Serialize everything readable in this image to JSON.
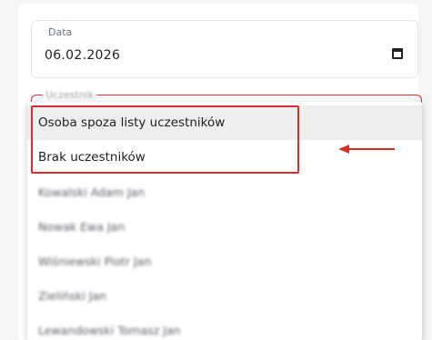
{
  "date_field": {
    "label": "Data",
    "value": "06.02.2026",
    "icon": "calendar-icon"
  },
  "participant_field": {
    "label": "Uczestnik"
  },
  "dropdown": {
    "options": [
      {
        "label": "Osoba spoza listy uczestników",
        "state": "highlighted"
      },
      {
        "label": "Brak uczestników"
      },
      {
        "label": "Kowalski Adam Jan"
      },
      {
        "label": "Nowak Ewa Jan"
      },
      {
        "label": "Wiśniewski Piotr Jan"
      },
      {
        "label": "Zieliński Jan"
      },
      {
        "label": "Lewandowski Tomasz Jan"
      }
    ]
  },
  "annotation": {
    "color": "#d62d2d"
  }
}
